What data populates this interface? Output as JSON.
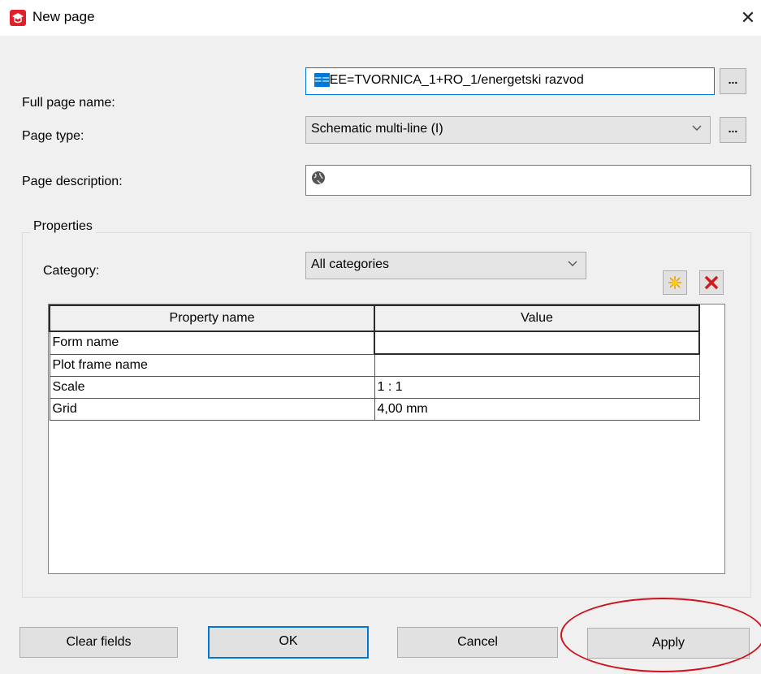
{
  "window": {
    "title": "New page",
    "close_glyph": "✕"
  },
  "form": {
    "full_page_name": {
      "label": "Full page name:",
      "prefix": "==",
      "value": "EE=TVORNICA_1+RO_1/energetski razvod",
      "button": "..."
    },
    "page_type": {
      "label": "Page type:",
      "value": "Schematic multi-line (I)",
      "button": "..."
    },
    "page_description": {
      "label": "Page description:",
      "value": "",
      "icon": "globe-icon"
    }
  },
  "properties": {
    "group_label": "Properties",
    "category_label": "Category:",
    "category_value": "All categories",
    "tool_new_icon": "new-star-icon",
    "tool_delete_icon": "delete-x-icon",
    "columns": [
      "Property name",
      "Value"
    ],
    "rows": [
      {
        "name": "Form name",
        "value": ""
      },
      {
        "name": "Plot frame name",
        "value": ""
      },
      {
        "name": "Scale",
        "value": "1 : 1"
      },
      {
        "name": "Grid",
        "value": "4,00 mm"
      }
    ]
  },
  "buttons": {
    "clear": "Clear fields",
    "ok": "OK",
    "cancel": "Cancel",
    "apply": "Apply"
  },
  "colors": {
    "accent": "#0078d7",
    "annotation": "#d0101a",
    "icon_red": "#e0202a"
  }
}
